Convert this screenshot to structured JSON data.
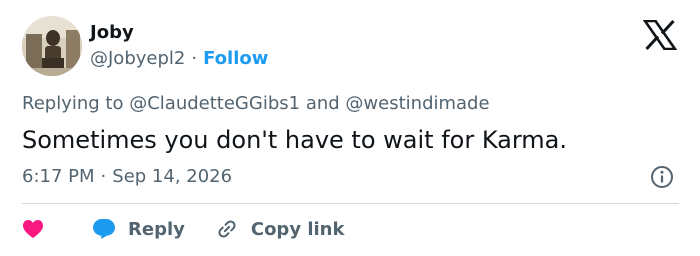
{
  "author": {
    "name": "Joby",
    "handle": "@Jobyepl2",
    "separator": "·",
    "follow_label": "Follow"
  },
  "reply": {
    "prefix": "Replying to",
    "user1": "@ClaudetteGGibs1",
    "conjunction": "and",
    "user2": "@westindimade"
  },
  "tweet": {
    "text": "Sometimes you don't have to wait for Karma.",
    "time": "6:17 PM",
    "separator": "·",
    "date": "Sep 14, 2026"
  },
  "actions": {
    "like_icon": "heart-icon",
    "reply_label": "Reply",
    "reply_icon": "speech-bubble-icon",
    "copy_label": "Copy link",
    "copy_icon": "link-icon"
  },
  "colors": {
    "accent": "#1d9bf0",
    "like": "#f91880",
    "text": "#0f1419",
    "muted": "#536471",
    "divider": "#cfd9de"
  },
  "icons": {
    "brand": "x-logo-icon",
    "info": "info-icon"
  }
}
